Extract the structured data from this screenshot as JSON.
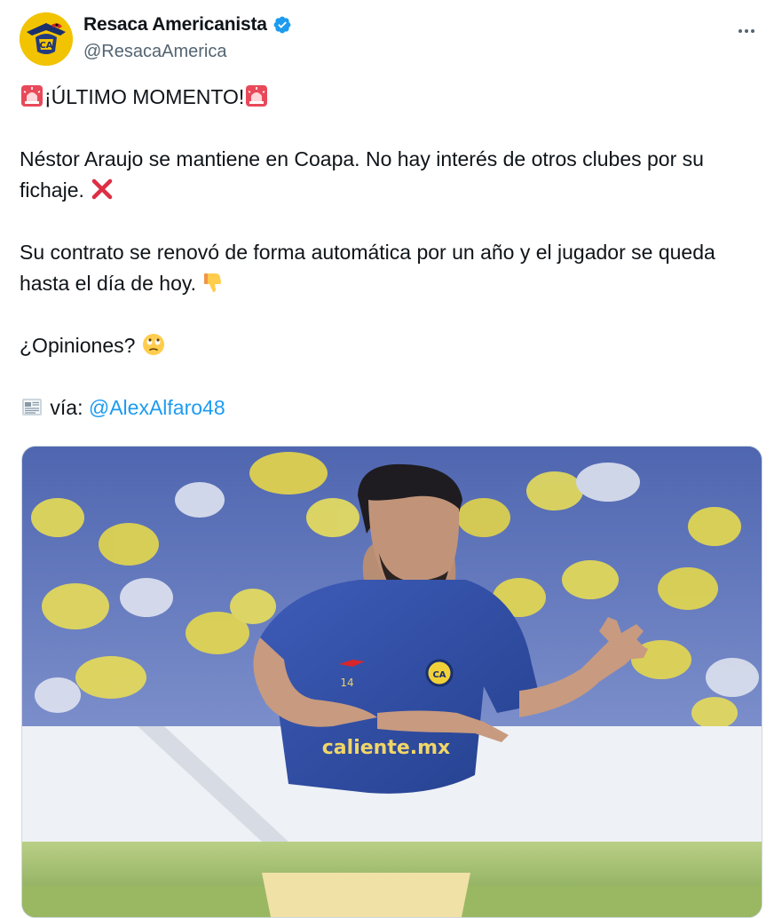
{
  "author": {
    "display_name": "Resaca Americanista",
    "handle": "@ResacaAmerica",
    "verified": true,
    "avatar_icon": "eagle-logo",
    "avatar_color": "#f2c300"
  },
  "menu": {
    "icon": "more-horizontal-icon"
  },
  "tweet": {
    "line1": "¡ÚLTIMO MOMENTO!",
    "line2": "Néstor Araujo se mantiene en Coapa. No hay interés de otros clubes por su fichaje.",
    "line3": "Su contrato se renovó de forma automática por un año y el jugador se queda hasta el día de hoy.",
    "line4": "¿Opiniones?",
    "via_label": "vía:",
    "mention": "@AlexAlfaro48",
    "emojis": [
      "siren-icon",
      "red-x-icon",
      "thumbs-down-icon",
      "eye-roll-face-icon",
      "newspaper-icon"
    ]
  },
  "media": {
    "description_icon": "player-photo",
    "jersey_number": "14",
    "sponsor": "caliente.mx"
  },
  "colors": {
    "link": "#1d9bf0",
    "secondary_text": "#536471",
    "verified": "#1d9bf0"
  }
}
